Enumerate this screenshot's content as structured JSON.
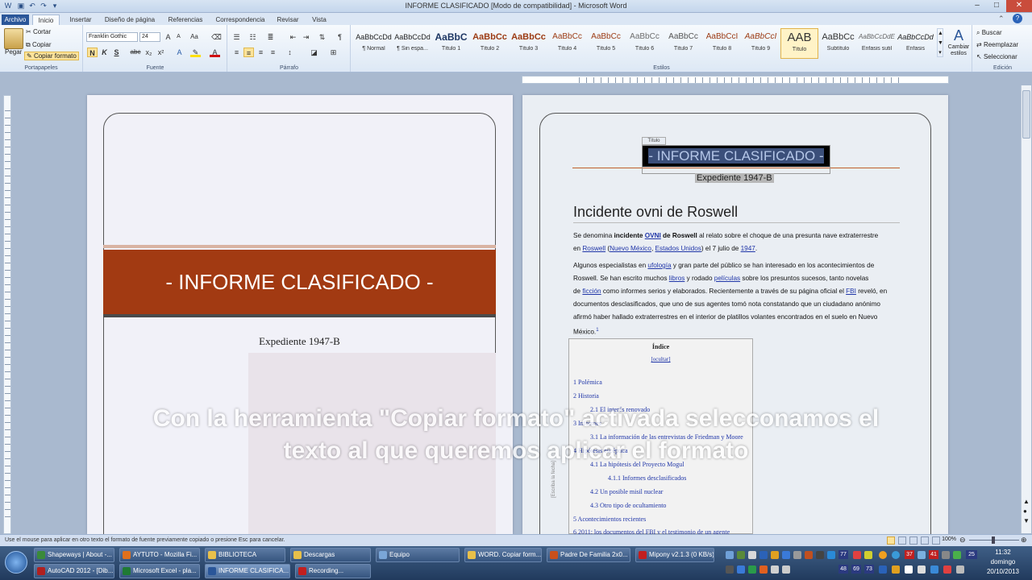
{
  "window": {
    "title": "INFORME CLASIFICADO [Modo de compatibilidad] - Microsoft Word",
    "minimize": "–",
    "maximize": "□",
    "close": "✕"
  },
  "tabs": [
    "Archivo",
    "Inicio",
    "Insertar",
    "Diseño de página",
    "Referencias",
    "Correspondencia",
    "Revisar",
    "Vista"
  ],
  "active_tab": "Inicio",
  "ribbon": {
    "portapapeles": {
      "label": "Portapapeles",
      "pegar": "Pegar",
      "cortar": "Cortar",
      "copiar": "Copiar",
      "copiar_formato": "Copiar formato"
    },
    "fuente": {
      "label": "Fuente",
      "font_name": "Franklin Gothic",
      "font_size": "24",
      "bold": "N",
      "italic": "K",
      "underline": "S",
      "strike": "abc",
      "sub": "x₂",
      "sup": "x²",
      "grow": "A",
      "shrink": "A",
      "case": "Aa"
    },
    "parrafo": {
      "label": "Párrafo"
    },
    "estilos": {
      "label": "Estilos",
      "items": [
        {
          "preview": "AaBbCcDd",
          "name": "¶ Normal"
        },
        {
          "preview": "AaBbCcDd",
          "name": "¶ Sin espa..."
        },
        {
          "preview": "AaBbC",
          "name": "Título 1"
        },
        {
          "preview": "AaBbCc",
          "name": "Título 2"
        },
        {
          "preview": "AaBbCc",
          "name": "Título 3"
        },
        {
          "preview": "AaBbCc",
          "name": "Título 4"
        },
        {
          "preview": "AaBbCc",
          "name": "Título 5"
        },
        {
          "preview": "AaBbCc",
          "name": "Título 6"
        },
        {
          "preview": "AaBbCc",
          "name": "Título 7"
        },
        {
          "preview": "AaBbCcI",
          "name": "Título 8"
        },
        {
          "preview": "AaBbCcI",
          "name": "Título 9"
        },
        {
          "preview": "AAB",
          "name": "Título"
        },
        {
          "preview": "AaBbCc",
          "name": "Subtítulo"
        },
        {
          "preview": "AaBbCcDdE",
          "name": "Énfasis sutil"
        },
        {
          "preview": "AaBbCcDd",
          "name": "Énfasis"
        }
      ],
      "cambiar": "Cambiar estilos"
    },
    "edicion": {
      "label": "Edición",
      "buscar": "Buscar",
      "reemplazar": "Reemplazar",
      "seleccionar": "Seleccionar"
    }
  },
  "page1": {
    "banner": "- INFORME CLASIFICADO -",
    "subtitle": "Expediente 1947-B"
  },
  "page2": {
    "tag": "Título",
    "title_selected": "- INFORME CLASIFICADO -",
    "subtitle": "Expediente 1947-B",
    "heading": "Incidente ovni de Roswell",
    "side_tag": "[Escriba la fecha]",
    "p1": {
      "a": "Se denomina ",
      "b": "incidente ",
      "c": "OVNI",
      "d": " de Roswell",
      "e": " al relato sobre el choque de una presunta nave extraterrestre",
      "f": "en ",
      "g": "Roswell",
      "h": " (",
      "i": "Nuevo México",
      "j": ", ",
      "k": "Estados Unidos",
      "l": ") el 7 julio de ",
      "m": "1947",
      "n": "."
    },
    "p2": {
      "a": "Algunos especialistas en ",
      "b": "ufología",
      "c": " y gran parte del público se han interesado en los acontecimientos de",
      "d": "Roswell. Se han escrito muchos ",
      "e": "libros",
      "f": " y rodado ",
      "g": "películas",
      "h": " sobre los presuntos sucesos, tanto novelas",
      "i": "de ",
      "j": "ficción",
      "k": " como informes serios y elaborados. Recientemente a través de su página oficial el ",
      "l": "FBI",
      "m": " reveló, en",
      "n": "documentos desclasificados, que uno de sus agentes tomó nota constatando que un ciudadano anónimo",
      "o": "afirmó haber hallado extraterrestres en el interior de platillos volantes encontrados en el suelo en Nuevo",
      "p": "México.",
      "q": "1"
    },
    "toc": {
      "title": "Índice",
      "hide": "[ocultar]",
      "items": [
        "1 Polémica",
        "2 Historia",
        "2.1 El interés renovado",
        "3 Informes",
        "3.1 La información de las entrevistas de Friedman y Moore",
        "4 Hipótesis escéptica",
        "4.1 La hipótesis del Proyecto Mogul",
        "4.1.1 Informes desclasificados",
        "4.2 Un posible misil nuclear",
        "4.3 Otro tipo de ocultamiento",
        "5 Acontecimientos  recientes",
        "6 2011: los documentos  del FBI y el testimonio de un agente"
      ]
    }
  },
  "overlay": {
    "line1": "Con la herramienta \"Copiar formato\" activada selecconamos el",
    "line2": "texto al que queremos aplicar el formato"
  },
  "statusbar": {
    "text": "Use el mouse para aplicar en otro texto el formato de fuente previamente copiado o presione Esc para cancelar.",
    "zoom": "100%"
  },
  "taskbar": {
    "row1": [
      {
        "label": "Shapeways | About -...",
        "color": "#3a8a3a"
      },
      {
        "label": "AYTUTO - Mozilla Fi...",
        "color": "#e0701c"
      },
      {
        "label": "BIBLIOTECA",
        "color": "#e8c04a"
      },
      {
        "label": "Descargas",
        "color": "#e8c04a"
      },
      {
        "label": "Equipo",
        "color": "#7aa6d8"
      },
      {
        "label": "WORD. Copiar form...",
        "color": "#e8c04a"
      },
      {
        "label": "Padre De Familia 2x0...",
        "color": "#c8501c"
      },
      {
        "label": "Mipony v2.1.3 (0 KB/s)",
        "color": "#c21f1f"
      }
    ],
    "row2": [
      {
        "label": "AutoCAD 2012 - [Dib...",
        "color": "#b02020"
      },
      {
        "label": "Microsoft Excel - pla...",
        "color": "#1f7a34"
      },
      {
        "label": "INFORME CLASIFICA...",
        "color": "#2a5699"
      },
      {
        "label": "Recording...",
        "color": "#c21f1f"
      }
    ],
    "clock": {
      "time": "11:32",
      "day": "domingo",
      "date": "20/10/2013"
    },
    "tray_numbers": [
      "77",
      "37",
      "41",
      "48",
      "69",
      "73",
      "25"
    ]
  }
}
